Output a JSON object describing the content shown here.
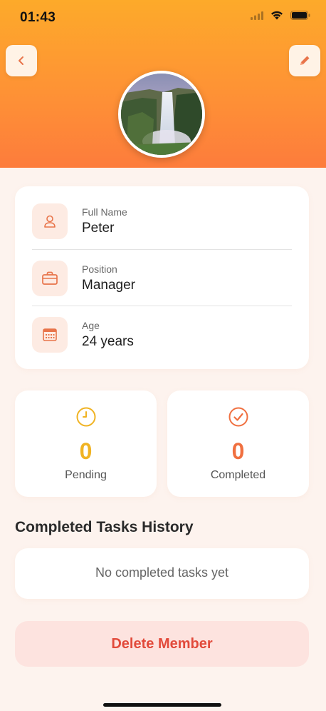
{
  "status_bar": {
    "time": "01:43"
  },
  "header": {
    "back_icon": "chevron-left-icon",
    "edit_icon": "pencil-icon",
    "avatar_desc": "waterfall-photo"
  },
  "info": [
    {
      "icon": "person-icon",
      "label": "Full Name",
      "value": "Peter"
    },
    {
      "icon": "briefcase-icon",
      "label": "Position",
      "value": "Manager"
    },
    {
      "icon": "calendar-icon",
      "label": "Age",
      "value": "24 years"
    }
  ],
  "stats": {
    "pending": {
      "icon": "clock-icon",
      "value": "0",
      "label": "Pending",
      "color": "#f0b323"
    },
    "completed": {
      "icon": "check-circle-icon",
      "value": "0",
      "label": "Completed",
      "color": "#f07040"
    }
  },
  "history": {
    "title": "Completed Tasks History",
    "empty_text": "No completed tasks yet"
  },
  "actions": {
    "delete_label": "Delete Member"
  },
  "colors": {
    "accent": "#fd8a36",
    "icon": "#e8744a",
    "danger": "#e24a3b",
    "danger_bg": "#fde3df",
    "background": "#fdf3ee"
  }
}
